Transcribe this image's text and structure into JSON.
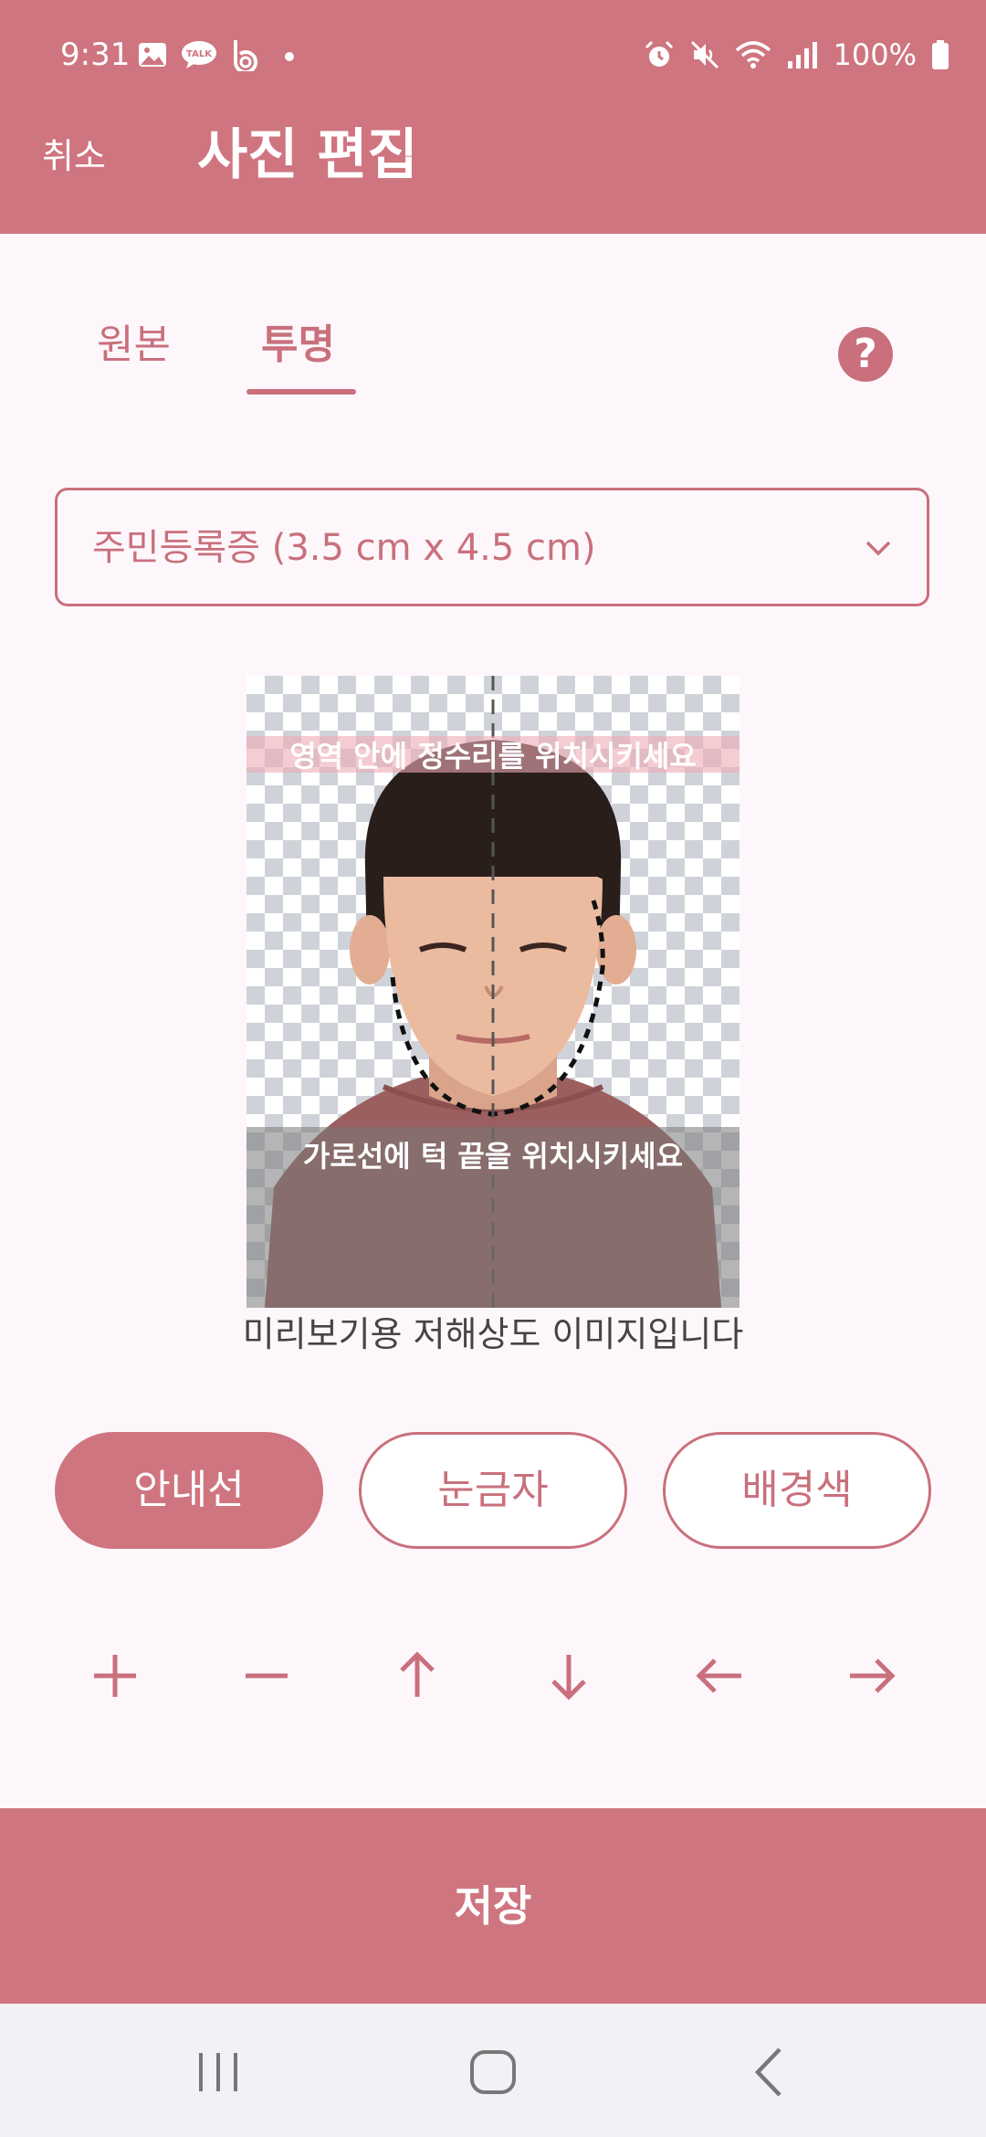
{
  "status_bar": {
    "time": "9:31",
    "battery": "100%",
    "left_icons": [
      "gallery-icon",
      "talk-icon",
      "b-app-icon",
      "dot-icon"
    ],
    "right_icons": [
      "alarm-icon",
      "mute-icon",
      "wifi-icon",
      "signal-icon",
      "battery-icon"
    ]
  },
  "header": {
    "cancel_label": "취소",
    "title": "사진 편집"
  },
  "tabs": [
    {
      "label": "원본",
      "selected": false
    },
    {
      "label": "투명",
      "selected": true
    }
  ],
  "help_label": "?",
  "size_select": {
    "value": "주민등록증 (3.5 cm x 4.5 cm)"
  },
  "photo": {
    "hint_top": "영역 안에 정수리를 위치시키세요",
    "hint_bottom": "가로선에 턱 끝을 위치시키세요",
    "caption": "미리보기용 저해상도 이미지입니다"
  },
  "mode_buttons": [
    {
      "label": "안내선",
      "selected": true
    },
    {
      "label": "눈금자",
      "selected": false
    },
    {
      "label": "배경색",
      "selected": false
    }
  ],
  "adjust_controls": [
    "zoom-in-icon",
    "zoom-out-icon",
    "move-up-icon",
    "move-down-icon",
    "move-left-icon",
    "move-right-icon"
  ],
  "save_label": "저장",
  "colors": {
    "brand": "#cf7580",
    "accent_text": "#c9707c",
    "background": "#fdf7fb"
  }
}
